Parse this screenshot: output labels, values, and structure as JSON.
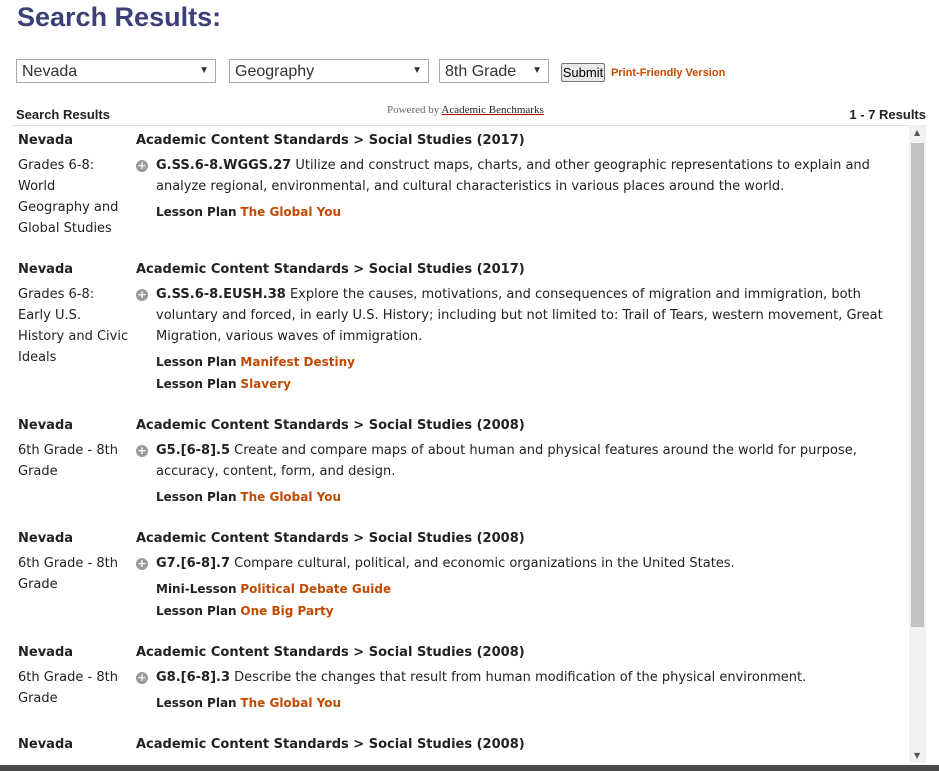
{
  "page": {
    "title": "Search Results:",
    "filters": {
      "state": "Nevada",
      "subject": "Geography",
      "grade": "8th Grade"
    },
    "submit_label": "Submit",
    "print_label": "Print-Friendly Version"
  },
  "results_header": {
    "label": "Search Results",
    "powered_prefix": "Powered by",
    "powered_brand": "Academic Benchmarks",
    "count": "1 - 7 Results"
  },
  "results": [
    {
      "state": "Nevada",
      "grade": "Grades 6-8: World Geography and Global Studies",
      "standard": "Academic Content Standards > Social Studies (2017)",
      "code": "G.SS.6-8.WGGS.27",
      "description": "Utilize and construct maps, charts, and other geographic representations to explain and analyze regional, environmental, and cultural characteristics in various places around the world.",
      "lessons": [
        {
          "kind": "Lesson Plan",
          "title": "The Global You"
        }
      ]
    },
    {
      "state": "Nevada",
      "grade": "Grades 6-8: Early U.S. History and Civic Ideals",
      "standard": "Academic Content Standards > Social Studies (2017)",
      "code": "G.SS.6-8.EUSH.38",
      "description": "Explore the causes, motivations, and consequences of migration and immigration, both voluntary and forced, in early U.S. History; including but not limited to: Trail of Tears, western movement, Great Migration, various waves of immigration.",
      "lessons": [
        {
          "kind": "Lesson Plan",
          "title": "Manifest Destiny"
        },
        {
          "kind": "Lesson Plan",
          "title": "Slavery"
        }
      ]
    },
    {
      "state": "Nevada",
      "grade": "6th Grade - 8th Grade",
      "standard": "Academic Content Standards > Social Studies (2008)",
      "code": "G5.[6-8].5",
      "description": "Create and compare maps of about human and physical features around the world for purpose, accuracy, content, form, and design.",
      "lessons": [
        {
          "kind": "Lesson Plan",
          "title": "The Global You"
        }
      ]
    },
    {
      "state": "Nevada",
      "grade": "6th Grade - 8th Grade",
      "standard": "Academic Content Standards > Social Studies (2008)",
      "code": "G7.[6-8].7",
      "description": "Compare cultural, political, and economic organizations in the United States.",
      "lessons": [
        {
          "kind": "Mini-Lesson",
          "title": "Political Debate Guide"
        },
        {
          "kind": "Lesson Plan",
          "title": "One Big Party"
        }
      ]
    },
    {
      "state": "Nevada",
      "grade": "6th Grade - 8th Grade",
      "standard": "Academic Content Standards > Social Studies (2008)",
      "code": "G8.[6-8].3",
      "description": "Describe the changes that result from human modification of the physical environment.",
      "lessons": [
        {
          "kind": "Lesson Plan",
          "title": "The Global You"
        }
      ]
    },
    {
      "state": "Nevada",
      "grade": "",
      "standard": "Academic Content Standards > Social Studies (2008)",
      "code": "",
      "description": "",
      "lessons": []
    }
  ],
  "colors": {
    "title": "#3b4178",
    "link": "#c14a00"
  }
}
